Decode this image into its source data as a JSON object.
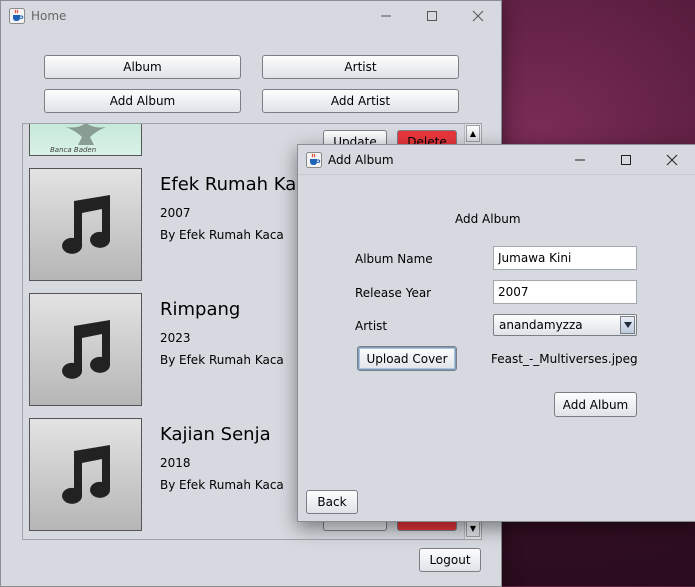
{
  "home": {
    "title": "Home",
    "buttons": {
      "album": "Album",
      "artist": "Artist",
      "add_album": "Add Album",
      "add_artist": "Add Artist"
    },
    "top_item": {
      "update": "Update",
      "delete": "Delete",
      "cover_text": "Banca Baden"
    },
    "albums": [
      {
        "title": "Efek Rumah Kaca",
        "year": "2007",
        "by_label": "By",
        "artist": "Efek Rumah Kaca"
      },
      {
        "title": "Rimpang",
        "year": "2023",
        "by_label": "By",
        "artist": "Efek Rumah Kaca"
      },
      {
        "title": "Kajian Senja",
        "year": "2018",
        "by_label": "By",
        "artist": "Efek Rumah Kaca"
      }
    ],
    "logout": "Logout"
  },
  "dialog": {
    "title": "Add Album",
    "heading": "Add Album",
    "album_name_label": "Album Name",
    "album_name_value": "Jumawa Kini",
    "release_year_label": "Release Year",
    "release_year_value": "2007",
    "artist_label": "Artist",
    "artist_selected": "anandamyzza",
    "upload_cover": "Upload Cover",
    "cover_file": "Feast_-_Multiverses.jpeg",
    "submit": "Add Album",
    "back": "Back"
  },
  "icons": {
    "app": "java-cup-icon",
    "minimize": "minimize-icon",
    "maximize": "maximize-icon",
    "close": "close-icon",
    "cover": "music-note-icon"
  },
  "colors": {
    "window_bg": "#d6d9df",
    "delete_red": "#e8363b",
    "desktop": "#4a1734"
  }
}
